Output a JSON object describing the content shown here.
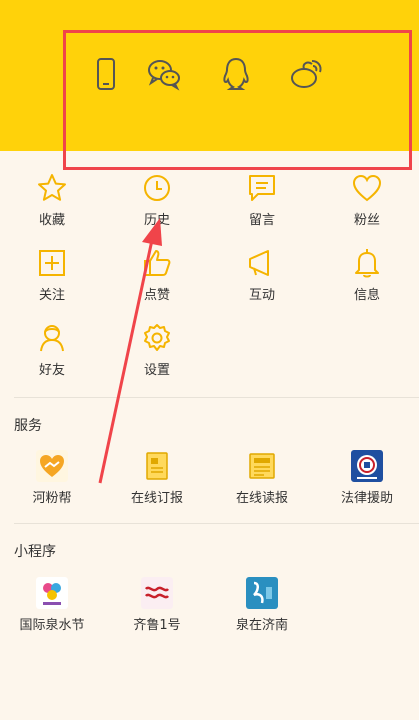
{
  "accent_color": "#ffd20a",
  "icon_color": "#f5b400",
  "annotation_color": "#f0444a",
  "login_options": [
    {
      "icon": "phone-icon"
    },
    {
      "icon": "wechat-icon"
    },
    {
      "icon": "qq-icon"
    },
    {
      "icon": "weibo-icon"
    }
  ],
  "my_menu": [
    {
      "label": "收藏",
      "icon": "star-icon"
    },
    {
      "label": "历史",
      "icon": "clock-icon"
    },
    {
      "label": "留言",
      "icon": "message-icon"
    },
    {
      "label": "粉丝",
      "icon": "heart-icon"
    },
    {
      "label": "关注",
      "icon": "plus-square-icon"
    },
    {
      "label": "点赞",
      "icon": "thumbs-up-icon"
    },
    {
      "label": "互动",
      "icon": "megaphone-icon"
    },
    {
      "label": "信息",
      "icon": "bell-icon"
    },
    {
      "label": "好友",
      "icon": "friend-icon"
    },
    {
      "label": "设置",
      "icon": "gear-icon"
    }
  ],
  "services": {
    "title": "服务",
    "items": [
      {
        "label": "河粉帮",
        "icon": "heart-hand-icon"
      },
      {
        "label": "在线订报",
        "icon": "newspaper-icon"
      },
      {
        "label": "在线读报",
        "icon": "reader-icon"
      },
      {
        "label": "法律援助",
        "icon": "legal-aid-icon"
      }
    ]
  },
  "mini_programs": {
    "title": "小程序",
    "items": [
      {
        "label": "国际泉水节",
        "icon": "spring-festival-icon"
      },
      {
        "label": "齐鲁1号",
        "icon": "qilu-icon"
      },
      {
        "label": "泉在济南",
        "icon": "quan-jinan-icon"
      }
    ]
  }
}
